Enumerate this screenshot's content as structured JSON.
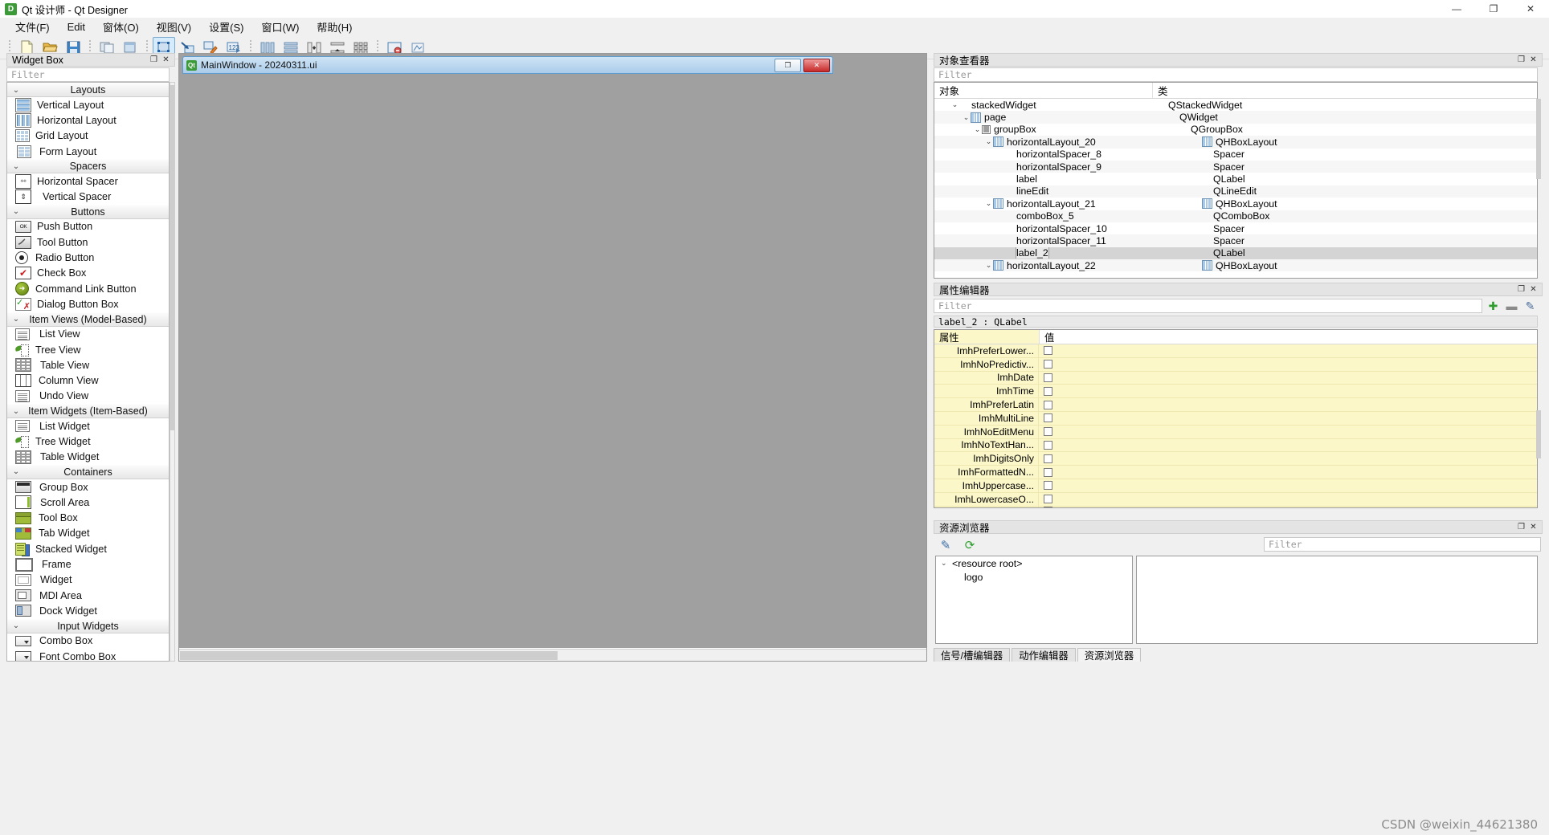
{
  "window": {
    "app_icon": "D",
    "title": "Qt 设计师 - Qt Designer",
    "minimize": "—",
    "maximize": "❐",
    "close": "✕"
  },
  "menubar": [
    {
      "label": "文件(F)"
    },
    {
      "label": "Edit"
    },
    {
      "label": "窗体(O)"
    },
    {
      "label": "视图(V)"
    },
    {
      "label": "设置(S)"
    },
    {
      "label": "窗口(W)"
    },
    {
      "label": "帮助(H)"
    }
  ],
  "toolbar": {
    "groups": [
      [
        "new-file-icon",
        "open-folder-icon",
        "save-icon"
      ],
      [
        "copy-window-icon",
        "paste-window-icon"
      ],
      [
        "edit-widgets-icon",
        "edit-signals-slots-icon",
        "edit-buddies-icon",
        "edit-tab-order-icon"
      ],
      [
        "layout-horizontally-icon",
        "layout-vertically-icon",
        "layout-splitter-h-icon",
        "layout-splitter-v-icon",
        "layout-grid-icon"
      ],
      [
        "break-layout-icon",
        "adjust-size-icon"
      ]
    ]
  },
  "widget_box": {
    "title": "Widget Box",
    "filter_placeholder": "Filter",
    "float_icon": "❐",
    "close_icon": "✕",
    "groups": [
      {
        "name": "Layouts",
        "chevron": "⌄",
        "items": [
          {
            "label": "Vertical Layout",
            "icon": "vertical-layout-icon"
          },
          {
            "label": "Horizontal Layout",
            "icon": "horizontal-layout-icon"
          },
          {
            "label": "Grid Layout",
            "icon": "grid-layout-icon"
          },
          {
            "label": "Form Layout",
            "icon": "form-layout-icon"
          }
        ]
      },
      {
        "name": "Spacers",
        "chevron": "⌄",
        "items": [
          {
            "label": "Horizontal Spacer",
            "icon": "horizontal-spacer-icon"
          },
          {
            "label": "Vertical Spacer",
            "icon": "vertical-spacer-icon"
          }
        ]
      },
      {
        "name": "Buttons",
        "chevron": "⌄",
        "items": [
          {
            "label": "Push Button",
            "icon": "push-button-icon"
          },
          {
            "label": "Tool Button",
            "icon": "tool-button-icon"
          },
          {
            "label": "Radio Button",
            "icon": "radio-button-icon"
          },
          {
            "label": "Check Box",
            "icon": "check-box-icon"
          },
          {
            "label": "Command Link Button",
            "icon": "command-link-button-icon"
          },
          {
            "label": "Dialog Button Box",
            "icon": "dialog-button-box-icon"
          }
        ]
      },
      {
        "name": "Item Views (Model-Based)",
        "chevron": "⌄",
        "items": [
          {
            "label": "List View",
            "icon": "list-view-icon"
          },
          {
            "label": "Tree View",
            "icon": "tree-view-icon"
          },
          {
            "label": "Table View",
            "icon": "table-view-icon"
          },
          {
            "label": "Column View",
            "icon": "column-view-icon"
          },
          {
            "label": "Undo View",
            "icon": "undo-view-icon"
          }
        ]
      },
      {
        "name": "Item Widgets (Item-Based)",
        "chevron": "⌄",
        "items": [
          {
            "label": "List Widget",
            "icon": "list-widget-icon"
          },
          {
            "label": "Tree Widget",
            "icon": "tree-widget-icon"
          },
          {
            "label": "Table Widget",
            "icon": "table-widget-icon"
          }
        ]
      },
      {
        "name": "Containers",
        "chevron": "⌄",
        "items": [
          {
            "label": "Group Box",
            "icon": "group-box-icon"
          },
          {
            "label": "Scroll Area",
            "icon": "scroll-area-icon"
          },
          {
            "label": "Tool Box",
            "icon": "tool-box-icon"
          },
          {
            "label": "Tab Widget",
            "icon": "tab-widget-icon"
          },
          {
            "label": "Stacked Widget",
            "icon": "stacked-widget-icon"
          },
          {
            "label": "Frame",
            "icon": "frame-icon"
          },
          {
            "label": "Widget",
            "icon": "widget-icon"
          },
          {
            "label": "MDI Area",
            "icon": "mdi-area-icon"
          },
          {
            "label": "Dock Widget",
            "icon": "dock-widget-icon"
          }
        ]
      },
      {
        "name": "Input Widgets",
        "chevron": "⌄",
        "items": [
          {
            "label": "Combo Box",
            "icon": "combo-box-icon"
          },
          {
            "label": "Font Combo Box",
            "icon": "font-combo-box-icon"
          }
        ]
      }
    ]
  },
  "form_window": {
    "title": "MainWindow - 20240311.ui",
    "icon": "Qt",
    "restore_label": "❐",
    "close_label": "✕"
  },
  "object_inspector": {
    "title": "对象查看器",
    "filter_placeholder": "Filter",
    "float_icon": "❐",
    "close_icon": "✕",
    "columns": [
      "对象",
      "类"
    ],
    "rows": [
      {
        "name": "stackedWidget",
        "class": "QStackedWidget",
        "indent": 1,
        "chevron": "⌄",
        "icon": "",
        "selected": false
      },
      {
        "name": "page",
        "class": "QWidget",
        "indent": 2,
        "chevron": "⌄",
        "icon": "hbox-mini-icon",
        "selected": false
      },
      {
        "name": "groupBox",
        "class": "QGroupBox",
        "indent": 3,
        "chevron": "⌄",
        "icon": "grid-mini-icon",
        "selected": false
      },
      {
        "name": "horizontalLayout_20",
        "class": "QHBoxLayout",
        "indent": 4,
        "chevron": "⌄",
        "icon": "hbox-mini-icon",
        "class_icon": "hbox-mini-icon",
        "selected": false
      },
      {
        "name": "horizontalSpacer_8",
        "class": "Spacer",
        "indent": 5,
        "chevron": "",
        "icon": "",
        "selected": false
      },
      {
        "name": "horizontalSpacer_9",
        "class": "Spacer",
        "indent": 5,
        "chevron": "",
        "icon": "",
        "selected": false
      },
      {
        "name": "label",
        "class": "QLabel",
        "indent": 5,
        "chevron": "",
        "icon": "",
        "selected": false
      },
      {
        "name": "lineEdit",
        "class": "QLineEdit",
        "indent": 5,
        "chevron": "",
        "icon": "",
        "selected": false
      },
      {
        "name": "horizontalLayout_21",
        "class": "QHBoxLayout",
        "indent": 4,
        "chevron": "⌄",
        "icon": "hbox-mini-icon",
        "class_icon": "hbox-mini-icon",
        "selected": false
      },
      {
        "name": "comboBox_5",
        "class": "QComboBox",
        "indent": 5,
        "chevron": "",
        "icon": "",
        "selected": false
      },
      {
        "name": "horizontalSpacer_10",
        "class": "Spacer",
        "indent": 5,
        "chevron": "",
        "icon": "",
        "selected": false
      },
      {
        "name": "horizontalSpacer_11",
        "class": "Spacer",
        "indent": 5,
        "chevron": "",
        "icon": "",
        "selected": false
      },
      {
        "name": "label_2",
        "class": "QLabel",
        "indent": 5,
        "chevron": "",
        "icon": "",
        "selected": true
      },
      {
        "name": "horizontalLayout_22",
        "class": "QHBoxLayout",
        "indent": 4,
        "chevron": "⌄",
        "icon": "hbox-mini-icon",
        "class_icon": "hbox-mini-icon",
        "selected": false
      }
    ]
  },
  "property_editor": {
    "title": "属性编辑器",
    "filter_placeholder": "Filter",
    "float_icon": "❐",
    "close_icon": "✕",
    "add_icon": "✚",
    "remove_icon": "▬",
    "config_icon": "✎",
    "object_line": "label_2 : QLabel",
    "columns": [
      "属性",
      "值"
    ],
    "rows": [
      {
        "key": "ImhPreferLower...",
        "value": ""
      },
      {
        "key": "ImhNoPredictiv...",
        "value": ""
      },
      {
        "key": "ImhDate",
        "value": ""
      },
      {
        "key": "ImhTime",
        "value": ""
      },
      {
        "key": "ImhPreferLatin",
        "value": ""
      },
      {
        "key": "ImhMultiLine",
        "value": ""
      },
      {
        "key": "ImhNoEditMenu",
        "value": ""
      },
      {
        "key": "ImhNoTextHan...",
        "value": ""
      },
      {
        "key": "ImhDigitsOnly",
        "value": ""
      },
      {
        "key": "ImhFormattedN...",
        "value": ""
      },
      {
        "key": "ImhUppercase...",
        "value": ""
      },
      {
        "key": "ImhLowercaseO...",
        "value": ""
      }
    ]
  },
  "resource_browser": {
    "title": "资源浏览器",
    "filter_placeholder": "Filter",
    "float_icon": "❐",
    "close_icon": "✕",
    "edit_icon": "✎",
    "reload_icon": "⟳",
    "tree": [
      {
        "label": "<resource root>",
        "indent": 0,
        "chevron": "⌄"
      },
      {
        "label": "logo",
        "indent": 1,
        "chevron": ""
      }
    ],
    "tabs": [
      {
        "label": "信号/槽编辑器",
        "active": false
      },
      {
        "label": "动作编辑器",
        "active": false
      },
      {
        "label": "资源浏览器",
        "active": true
      }
    ]
  },
  "watermark": "CSDN @weixin_44621380"
}
